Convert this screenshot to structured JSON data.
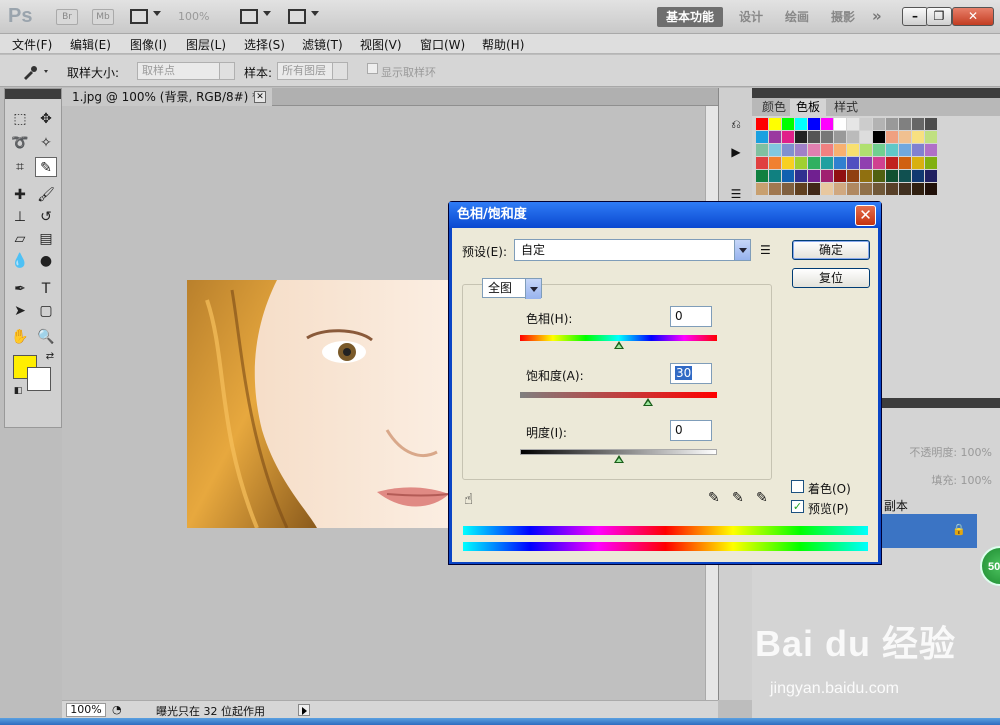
{
  "app": {
    "logo": "Ps",
    "mini_buttons": [
      "Br",
      "Mb"
    ],
    "zoom_display": "100%",
    "workspaces": [
      "基本功能",
      "设计",
      "绘画",
      "摄影"
    ],
    "workspace_more": "»",
    "window_buttons": [
      "–",
      "❐",
      "✕"
    ]
  },
  "menu": [
    "文件(F)",
    "编辑(E)",
    "图像(I)",
    "图层(L)",
    "选择(S)",
    "滤镜(T)",
    "视图(V)",
    "窗口(W)",
    "帮助(H)"
  ],
  "options": {
    "sample_size_label": "取样大小:",
    "sample_size_value": "取样点",
    "sample_label": "样本:",
    "sample_value": "所有图层",
    "show_ring_label": "显示取样环"
  },
  "document": {
    "tab_title": "1.jpg @ 100% (背景, RGB/8#) *",
    "close_glyph": "✕"
  },
  "status": {
    "zoom": "100%",
    "text": "曝光只在 32 位起作用"
  },
  "panels": {
    "tabs": [
      "颜色",
      "色板",
      "样式"
    ],
    "active_tab": "色板",
    "opacity_label": "不透明度:",
    "opacity_value": "100%",
    "fill_label": "填充:",
    "fill_value": "100%",
    "layer_name": "景 副本",
    "badge": "50"
  },
  "watermark": {
    "brand": "Bai du 经验",
    "url": "jingyan.baidu.com"
  },
  "dialog": {
    "title": "色相/饱和度",
    "close_glyph": "✕",
    "preset_label": "预设(E):",
    "preset_value": "自定",
    "ok_label": "确定",
    "reset_label": "复位",
    "channel_value": "全图",
    "hue_label": "色相(H):",
    "hue_value": "0",
    "saturation_label": "饱和度(A):",
    "saturation_value": "30",
    "lightness_label": "明度(I):",
    "lightness_value": "0",
    "hue_slider_fraction": 0.5,
    "saturation_slider_fraction": 0.65,
    "lightness_slider_fraction": 0.5,
    "colorize_label": "着色(O)",
    "colorize_checked": false,
    "preview_label": "预览(P)",
    "preview_checked": true
  },
  "colors": {
    "accent_blue": "#0a45c6",
    "foreground": "#ffee00",
    "background": "#ffffff",
    "layer_selected": "#3b74c4"
  }
}
